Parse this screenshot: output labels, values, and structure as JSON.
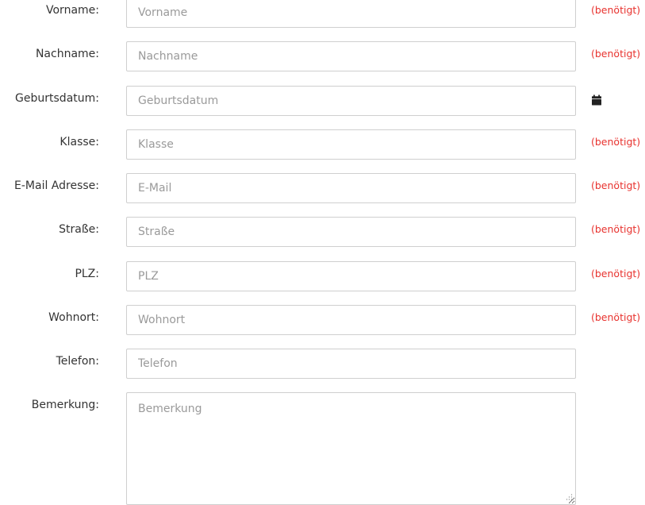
{
  "form": {
    "required_text": "(benötigt)",
    "calendar_icon": "calendar-icon",
    "fields": [
      {
        "label": "Vorname:",
        "placeholder": "Vorname",
        "required": true
      },
      {
        "label": "Nachname:",
        "placeholder": "Nachname",
        "required": true
      },
      {
        "label": "Geburtsdatum:",
        "placeholder": "Geburtsdatum",
        "required": false
      },
      {
        "label": "Klasse:",
        "placeholder": "Klasse",
        "required": true
      },
      {
        "label": "E-Mail Adresse:",
        "placeholder": "E-Mail",
        "required": true
      },
      {
        "label": "Straße:",
        "placeholder": "Straße",
        "required": true
      },
      {
        "label": "PLZ:",
        "placeholder": "PLZ",
        "required": true
      },
      {
        "label": "Wohnort:",
        "placeholder": "Wohnort",
        "required": true
      },
      {
        "label": "Telefon:",
        "placeholder": "Telefon",
        "required": false
      },
      {
        "label": "Bemerkung:",
        "placeholder": "Bemerkung",
        "required": false
      }
    ]
  },
  "colors": {
    "required": "#e8322e",
    "border": "#cfcfcf",
    "label": "#333333",
    "placeholder": "#9a9a9a"
  }
}
